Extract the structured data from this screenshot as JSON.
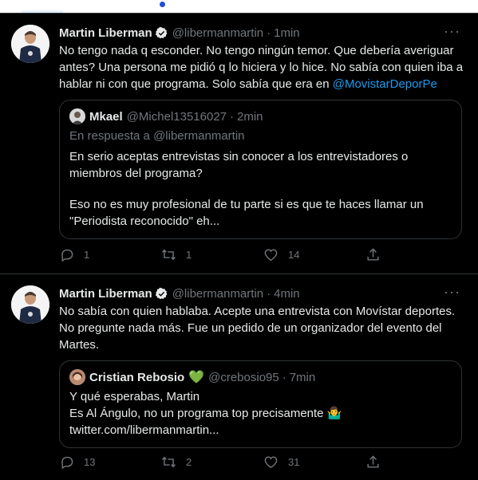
{
  "tweets": [
    {
      "author": "Martin Liberman",
      "handle": "@libermanmartin",
      "separator": "·",
      "time": "1min",
      "text": "No tengo nada q esconder. No tengo ningún temor. Que debería averiguar antes? Una persona me pidió q lo hiciera y lo hice. No sabía con quien iba a hablar ni con que programa. Solo sabía que era en ",
      "mention": "@MovistarDeporPe",
      "quote": {
        "author": "Mkael",
        "handle": "@Michel13516027",
        "separator": "·",
        "time": "2min",
        "replying_to": "En respuesta a @libermanmartin",
        "paragraph1": "En serio aceptas entrevistas sin conocer a los entrevistadores o miembros del programa?",
        "paragraph2": "Eso no es muy profesional de tu parte si es que te haces llamar un \"Periodista reconocido\" eh..."
      },
      "replies": "1",
      "retweets": "1",
      "likes": "14"
    },
    {
      "author": "Martin Liberman",
      "handle": "@libermanmartin",
      "separator": "·",
      "time": "4min",
      "text": "No sabía con quien hablaba. Acepte una entrevista con Movístar deportes. No pregunte nada más. Fue un pedido de un organizador del evento del Martes.",
      "quote": {
        "author": "Cristian Rebosio",
        "heart": "💚",
        "handle": "@crebosio95",
        "separator": "·",
        "time": "7min",
        "line1": "Y qué esperabas, Martin",
        "line2": "Es Al Ángulo, no un programa top precisamente 🤷‍♂️",
        "line3": "twitter.com/libermanmartin..."
      },
      "replies": "13",
      "retweets": "2",
      "likes": "31"
    }
  ],
  "more_glyph": "···",
  "colors": {
    "background": "#000000",
    "text": "#e7e9ea",
    "muted": "#71767b",
    "link": "#1d9bf0",
    "verified": "#1d9bf0",
    "border": "#2f3336"
  }
}
